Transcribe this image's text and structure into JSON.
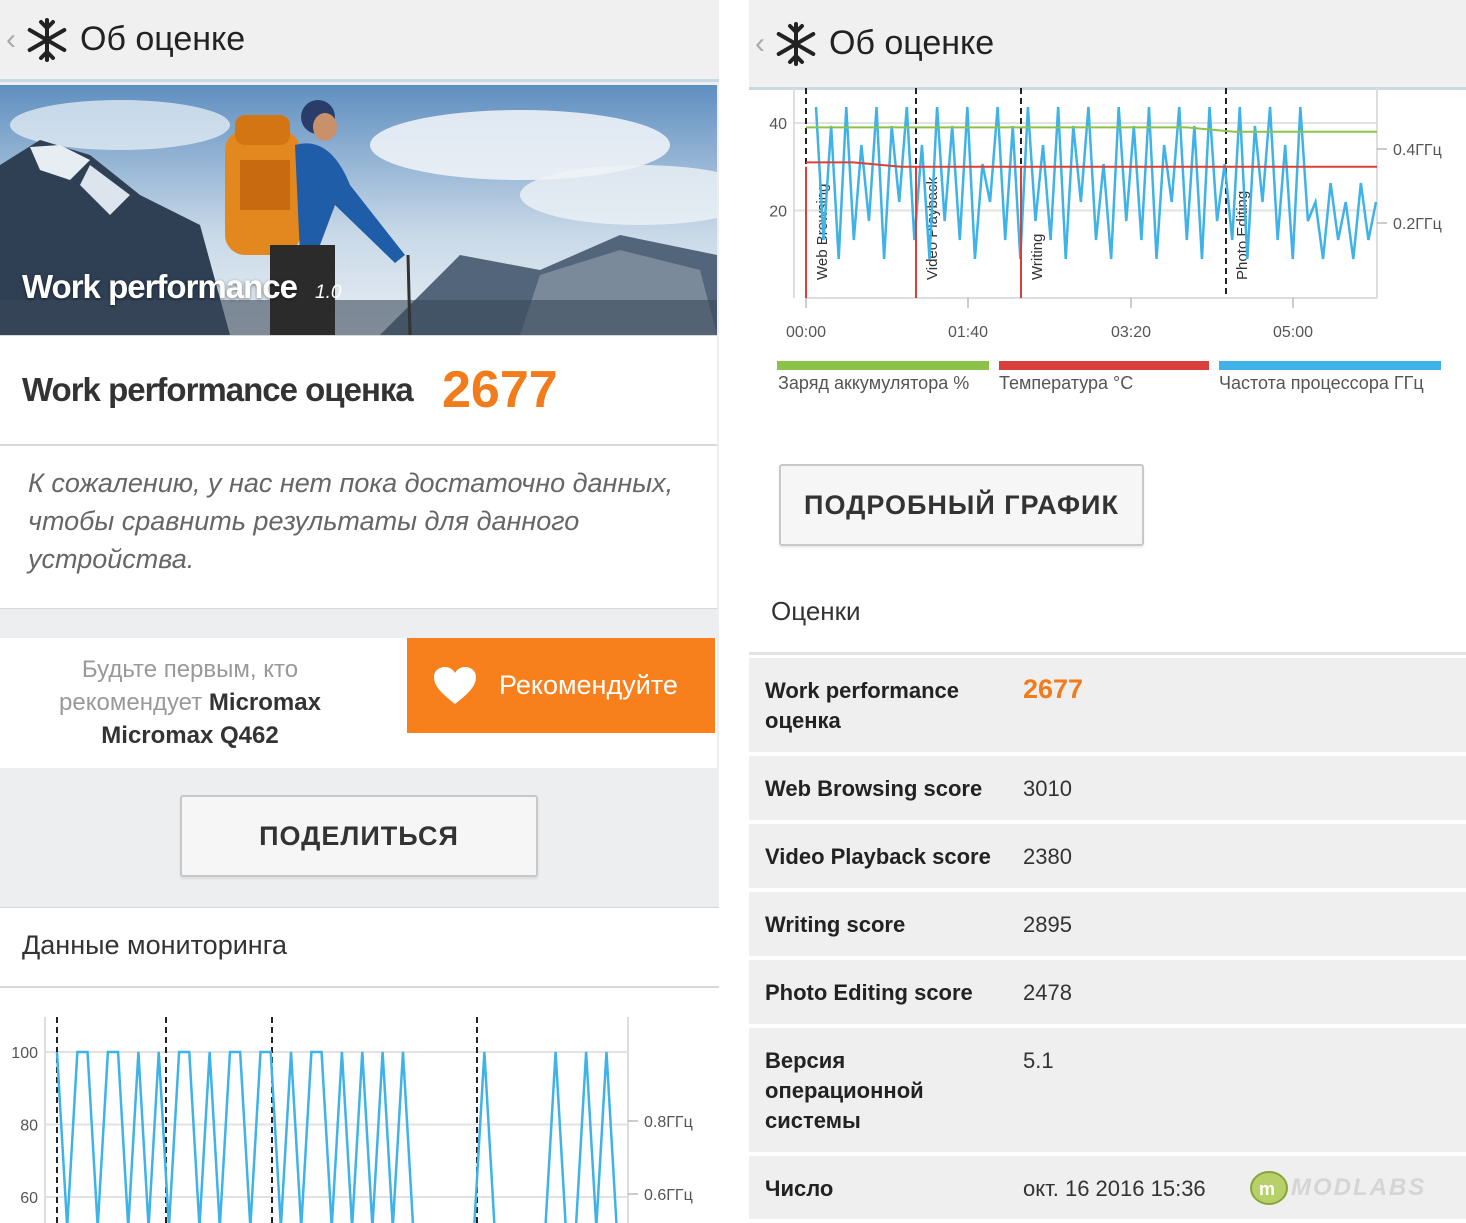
{
  "app": {
    "title": "Об оценке",
    "back_glyph": "‹"
  },
  "left": {
    "benchmark_name": "Work performance",
    "benchmark_version": "1.0",
    "score_label": "Work performance оценка",
    "score": "2677",
    "note": "К сожалению, у нас нет пока достаточно данных, чтобы сравнить результаты для данного устройства.",
    "recommend_prefix": "Будьте первым, кто рекомендует",
    "recommend_device": "Micromax Micromax Q462",
    "recommend_button": "Рекомендуйте",
    "share_button": "ПОДЕЛИТЬСЯ",
    "monitoring_title": "Данные мониторинга"
  },
  "chart_left": {
    "type": "line",
    "y_ticks": [
      "100",
      "80",
      "60"
    ],
    "y2_ticks": [
      "0.8ГГц",
      "0.6ГГц"
    ],
    "series": [
      {
        "values": [
          100,
          60,
          100,
          100,
          60,
          100,
          100,
          60,
          100,
          60,
          100,
          60,
          100,
          100,
          60,
          100,
          60,
          100,
          100,
          60,
          100,
          100,
          60,
          100,
          60,
          100,
          100,
          60,
          100,
          60,
          100,
          60,
          100,
          60,
          100,
          60,
          60,
          60,
          60,
          60,
          60,
          60,
          100,
          60,
          60,
          60,
          60,
          60,
          60,
          100,
          60,
          60,
          100,
          60,
          100,
          60,
          60,
          60
        ]
      }
    ]
  },
  "chart_right": {
    "type": "line",
    "y_ticks": [
      "40",
      "20"
    ],
    "y2_ticks": [
      "0.4ГГц",
      "0.2ГГц"
    ],
    "x_ticks": [
      "00:00",
      "01:40",
      "03:20",
      "05:00"
    ],
    "markers": [
      "Web Browsing",
      "Video Playback",
      "Writing",
      "Photo Editing"
    ],
    "series": [
      {
        "name": "Заряд аккумулятора %",
        "color": "#8bc34a",
        "values": [
          39,
          39,
          39,
          39,
          39,
          39,
          39,
          39,
          39,
          38,
          38,
          38,
          38
        ]
      },
      {
        "name": "Температура °C",
        "color": "#d9403a",
        "values": [
          31,
          31,
          30,
          30,
          30,
          30,
          30,
          30,
          30,
          30,
          30,
          30,
          30
        ]
      },
      {
        "name": "Частота процессора ГГц",
        "color": "#3fb3e8",
        "values": [
          0.45,
          0.1,
          0.4,
          0.05,
          0.45,
          0.1,
          0.35,
          0.15,
          0.45,
          0.05,
          0.4,
          0.2,
          0.45,
          0.1,
          0.35,
          0.05,
          0.45,
          0.15,
          0.4,
          0.1,
          0.45,
          0.05,
          0.3,
          0.2,
          0.45,
          0.1,
          0.4,
          0.05,
          0.45,
          0.15,
          0.35,
          0.1,
          0.45,
          0.05,
          0.4,
          0.2,
          0.45,
          0.1,
          0.3,
          0.05,
          0.45,
          0.15,
          0.4,
          0.1,
          0.45,
          0.05,
          0.35,
          0.2,
          0.45,
          0.1,
          0.4,
          0.05,
          0.45,
          0.15,
          0.3,
          0.1,
          0.45,
          0.05,
          0.4,
          0.2,
          0.45,
          0.1,
          0.35,
          0.05,
          0.45,
          0.15,
          0.2,
          0.05,
          0.25,
          0.1,
          0.2,
          0.05,
          0.25,
          0.1,
          0.2
        ]
      }
    ]
  },
  "right": {
    "legend_battery": "Заряд аккумулятора %",
    "legend_temp": "Температура °C",
    "legend_cpu": "Частота процессора ГГц",
    "detail_button": "ПОДРОБНЫЙ ГРАФИК",
    "scores_title": "Оценки",
    "rows": [
      {
        "k": "Work performance оценка",
        "v": "2677"
      },
      {
        "k": "Web Browsing score",
        "v": "3010"
      },
      {
        "k": "Video Playback score",
        "v": "2380"
      },
      {
        "k": "Writing score",
        "v": "2895"
      },
      {
        "k": "Photo Editing score",
        "v": "2478"
      },
      {
        "k": "Версия операционной системы",
        "v": "5.1"
      },
      {
        "k": "Число",
        "v": "окт. 16 2016 15:36"
      }
    ],
    "watermark": "MODLABS"
  }
}
